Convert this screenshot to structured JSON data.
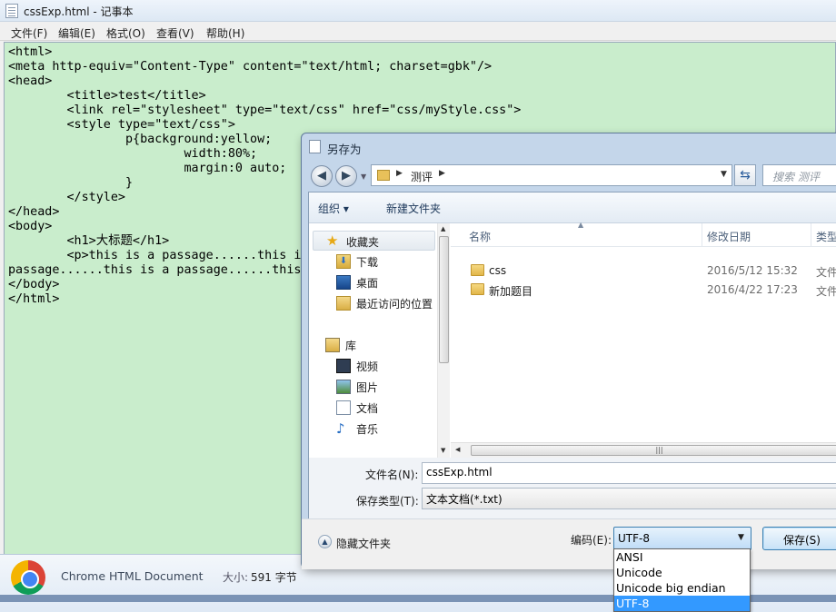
{
  "notepad": {
    "title": "cssExp.html - 记事本",
    "menu": [
      "文件(F)",
      "编辑(E)",
      "格式(O)",
      "查看(V)",
      "帮助(H)"
    ],
    "code_lines": [
      "<html>",
      "<meta http-equiv=\"Content-Type\" content=\"text/html; charset=gbk\"/>",
      "<head>",
      "        <title>test</title>",
      "        <link rel=\"stylesheet\" type=\"text/css\" href=\"css/myStyle.css\">",
      "        <style type=\"text/css\">",
      "                p{background:yellow;",
      "                        width:80%;",
      "                        margin:0 auto;",
      "                }",
      "        </style>",
      "</head>",
      "<body>",
      "        <h1>大标题</h1>",
      "        <p>this is a passage......this is",
      "passage......this is a passage......this",
      "</body>",
      "</html>"
    ]
  },
  "explorer_strip": {
    "file_type": "Chrome HTML Document",
    "size_label": "大小:",
    "size_value": "591 字节"
  },
  "dialog": {
    "title": "另存为",
    "address": {
      "crumb": "测评"
    },
    "search_placeholder": "搜索 测评",
    "toolbar": {
      "organize": "组织 ▾",
      "new_folder": "新建文件夹"
    },
    "nav": {
      "favorites": "收藏夹",
      "downloads": "下载",
      "desktop": "桌面",
      "recent": "最近访问的位置",
      "libraries": "库",
      "videos": "视频",
      "pictures": "图片",
      "documents": "文档",
      "music": "音乐"
    },
    "columns": {
      "name": "名称",
      "date": "修改日期",
      "type": "类型"
    },
    "files": [
      {
        "name": "css",
        "date": "2016/5/12 15:32",
        "type": "文件"
      },
      {
        "name": "新加题目",
        "date": "2016/4/22 17:23",
        "type": "文件"
      }
    ],
    "form": {
      "filename_label": "文件名(N):",
      "filename_value": "cssExp.html",
      "type_label": "保存类型(T):",
      "type_value": "文本文档(*.txt)"
    },
    "footer": {
      "hide_folders": "隐藏文件夹",
      "encoding_label": "编码(E):",
      "encoding_value": "UTF-8",
      "save": "保存(S)"
    }
  },
  "encoding_options": [
    "ANSI",
    "Unicode",
    "Unicode big endian",
    "UTF-8"
  ]
}
